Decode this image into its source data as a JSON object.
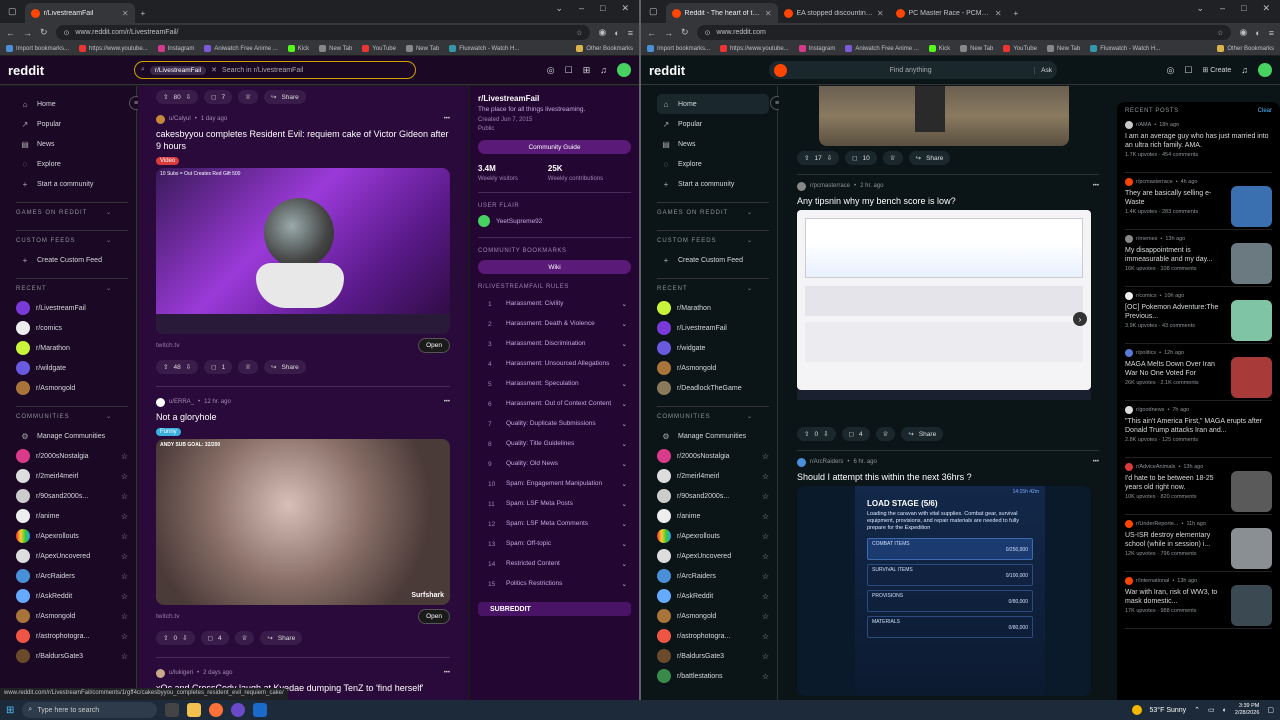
{
  "left": {
    "tabs": [
      {
        "title": "r/LivestreamFail"
      }
    ],
    "url": "www.reddit.com/r/LivestreamFail/",
    "bookmarks": [
      "Import bookmarks...",
      "https://www.youtube...",
      "Instagram",
      "Aniwatch Free Anime ...",
      "Kick",
      "New Tab",
      "YouTube",
      "New Tab",
      "Fluxwatch - Watch H..."
    ],
    "other_bookmarks": "Other Bookmarks",
    "logo": "reddit",
    "search_chip": "r/LivestreamFail",
    "search_placeholder": "Search in r/LivestreamFail",
    "nav": [
      "Home",
      "Popular",
      "News",
      "Explore",
      "Start a community"
    ],
    "sections": {
      "games": "GAMES ON REDDIT",
      "feeds": "CUSTOM FEEDS",
      "recent": "RECENT",
      "communities": "COMMUNITIES"
    },
    "create_feed": "Create Custom Feed",
    "recent": [
      "r/LivestreamFail",
      "r/comics",
      "r/Marathon",
      "r/wildgate",
      "r/Asmongold"
    ],
    "manage": "Manage Communities",
    "communities": [
      "r/2000sNostalgia",
      "r/2meirl4meirl",
      "r/90sand2000s...",
      "r/anime",
      "r/Apexrollouts",
      "r/ApexUncovered",
      "r/ArcRaiders",
      "r/AskReddit",
      "r/Asmongold",
      "r/astrophotogra...",
      "r/BaldursGate3"
    ],
    "top_actions": {
      "votes": "80",
      "comments": "7",
      "share": "Share"
    },
    "posts": [
      {
        "user": "u/Calyul",
        "age": "1 day ago",
        "title": "cakesbyyou completes Resident Evil: requiem cake of Victor Gideon after 9 hours",
        "flair": "Video",
        "video_caption": "10 Subs = Out Creates Red Gift 500",
        "link": "twitch.tv",
        "open": "Open",
        "votes": "48",
        "comments": "1",
        "share": "Share"
      },
      {
        "user": "u/ERRA_",
        "age": "12 hr. ago",
        "title": "Not a gloryhole",
        "flair": "Funny",
        "video_caption": "ANDY SUB GOAL: 32/200",
        "watermark": "Surfshark",
        "link": "twitch.tv",
        "open": "Open",
        "votes": "0",
        "comments": "4",
        "share": "Share"
      },
      {
        "user": "u/lukigeri",
        "age": "2 days ago",
        "title": "xQc and CrossCody laugh at Kyedae dumping TenZ to 'find herself'"
      }
    ],
    "sidebar": {
      "title": "r/LivestreamFail",
      "desc": "The place for all things livestreaming.",
      "created": "Created Jun 7, 2015",
      "visibility": "Public",
      "guide": "Community Guide",
      "visitors": "3.4M",
      "visitors_label": "Weekly visitors",
      "contribs": "25K",
      "contribs_label": "Weekly contributions",
      "user_flair_head": "USER FLAIR",
      "user_flair": "YeetSupreme92",
      "bookmarks_head": "COMMUNITY BOOKMARKS",
      "wiki": "Wiki",
      "rules_head": "R/LIVESTREAMFAIL RULES",
      "rules": [
        "Harassment: Civility",
        "Harassment: Death & Violence",
        "Harassment: Discrimination",
        "Harassment: Unsourced Allegations",
        "Harassment: Speculation",
        "Harassment: Out of Context Content",
        "Quality: Duplicate Submissions",
        "Quality: Title Guidelines",
        "Quality: Old News",
        "Spam: Engagement Manipulation",
        "Spam: LSF Meta Posts",
        "Spam: LSF Meta Comments",
        "Spam: Off-topic",
        "Restricted Content",
        "Politics Restrictions"
      ],
      "banner": "SUBREDDIT"
    },
    "status_url": "www.reddit.com/r/LivestreamFail/comments/1rgff4c/cakesbyyou_completes_resident_evil_requiem_cake/"
  },
  "right": {
    "tabs": [
      {
        "title": "Reddit - The heart of the intern"
      },
      {
        "title": "EA stopped discounting older E"
      },
      {
        "title": "PC Master Race - PCMR: A plac"
      }
    ],
    "url": "www.reddit.com",
    "bookmarks": [
      "Import bookmarks...",
      "https://www.youtube...",
      "Instagram",
      "Aniwatch Free Anime ...",
      "Kick",
      "New Tab",
      "YouTube",
      "New Tab",
      "Fluxwatch - Watch H..."
    ],
    "other_bookmarks": "Other Bookmarks",
    "logo": "reddit",
    "search_placeholder": "Find anything",
    "ask": "Ask",
    "create": "Create",
    "nav": [
      "Home",
      "Popular",
      "News",
      "Explore",
      "Start a community"
    ],
    "sections": {
      "games": "GAMES ON REDDIT",
      "feeds": "CUSTOM FEEDS",
      "recent": "RECENT",
      "communities": "COMMUNITIES"
    },
    "create_feed": "Create Custom Feed",
    "recent": [
      "r/Marathon",
      "r/LivestreamFail",
      "r/widgate",
      "r/Asmongold",
      "r/DeadlockTheGame"
    ],
    "manage": "Manage Communities",
    "communities": [
      "r/2000sNostalgia",
      "r/2meirl4meirl",
      "r/90sand2000s...",
      "r/anime",
      "r/Apexrollouts",
      "r/ApexUncovered",
      "r/ArcRaiders",
      "r/AskReddit",
      "r/Asmongold",
      "r/astrophotogra...",
      "r/BaldursGate3",
      "r/battlestations"
    ],
    "top_actions": {
      "votes": "17",
      "comments": "10",
      "share": "Share"
    },
    "posts": [
      {
        "sub": "r/pcmasterrace",
        "age": "2 hr. ago",
        "title": "Any tipsnin why my bench score is low?",
        "votes": "0",
        "comments": "4",
        "share": "Share"
      },
      {
        "sub": "r/ArcRaiders",
        "age": "6 hr. ago",
        "title": "Should I attempt this within the next 36hrs ?",
        "load_title": "LOAD STAGE (5/6)",
        "timer": "14:15h 42m",
        "load_desc": "Loading the caravan with vital supplies. Combat gear, survival equipment, provisions, and repair materials are needed to fully prepare for the Expedition",
        "sections": [
          {
            "name": "COMBAT ITEMS",
            "val": "0/250,000"
          },
          {
            "name": "SURVIVAL ITEMS",
            "val": "0/100,000"
          },
          {
            "name": "PROVISIONS",
            "val": "0/80,000"
          },
          {
            "name": "MATERIALS",
            "val": "0/80,000"
          }
        ]
      }
    ],
    "recent_posts": {
      "head": "RECENT POSTS",
      "clear": "Clear",
      "items": [
        {
          "sub": "r/AMA",
          "age": "18h ago",
          "title": "I am an average guy who has just married into an ultra rich family. AMA.",
          "stats": "1.7K upvotes · 454 comments",
          "thumb": ""
        },
        {
          "sub": "r/pcmasterrace",
          "age": "4h ago",
          "title": "They are basically selling e-Waste",
          "stats": "1.4K upvotes · 283 comments",
          "thumb": "#3a6fb0"
        },
        {
          "sub": "r/memes",
          "age": "13h ago",
          "title": "My disappointment is immeasurable and my day...",
          "stats": "16K upvotes · 108 comments",
          "thumb": "#6b7a80"
        },
        {
          "sub": "r/comics",
          "age": "10h ago",
          "title": "[OC] Pokemon Adventure:The Previous...",
          "stats": "3.9K upvotes · 43 comments",
          "thumb": "#7fc4a4"
        },
        {
          "sub": "r/politics",
          "age": "12h ago",
          "title": "MAGA Melts Down Over Iran War No One Voted For",
          "stats": "26K upvotes · 2.1K comments",
          "thumb": "#a83a3a"
        },
        {
          "sub": "r/goodnews",
          "age": "7h ago",
          "title": "\"This ain't America First,\" MAGA erupts after Donald Trump attacks Iran and...",
          "stats": "2.8K upvotes · 125 comments",
          "thumb": ""
        },
        {
          "sub": "r/AdviceAnimals",
          "age": "13h ago",
          "title": "I'd hate to be between 18-25 years old right now.",
          "stats": "10K upvotes · 820 comments",
          "thumb": "#5a5a5a"
        },
        {
          "sub": "r/UnderReporte...",
          "age": "11h ago",
          "title": "US-ISR destroy elementary school (while in session) i...",
          "stats": "12K upvotes · 796 comments",
          "thumb": "#8a8f94"
        },
        {
          "sub": "r/international",
          "age": "13h ago",
          "title": "War with Iran, risk of WW3, to mask domestic...",
          "stats": "17K upvotes · 988 comments",
          "thumb": "#3b4a52"
        }
      ]
    }
  },
  "taskbar": {
    "search": "Type here to search",
    "weather": "53°F Sunny",
    "time": "3:39 PM",
    "date": "2/28/2026"
  }
}
